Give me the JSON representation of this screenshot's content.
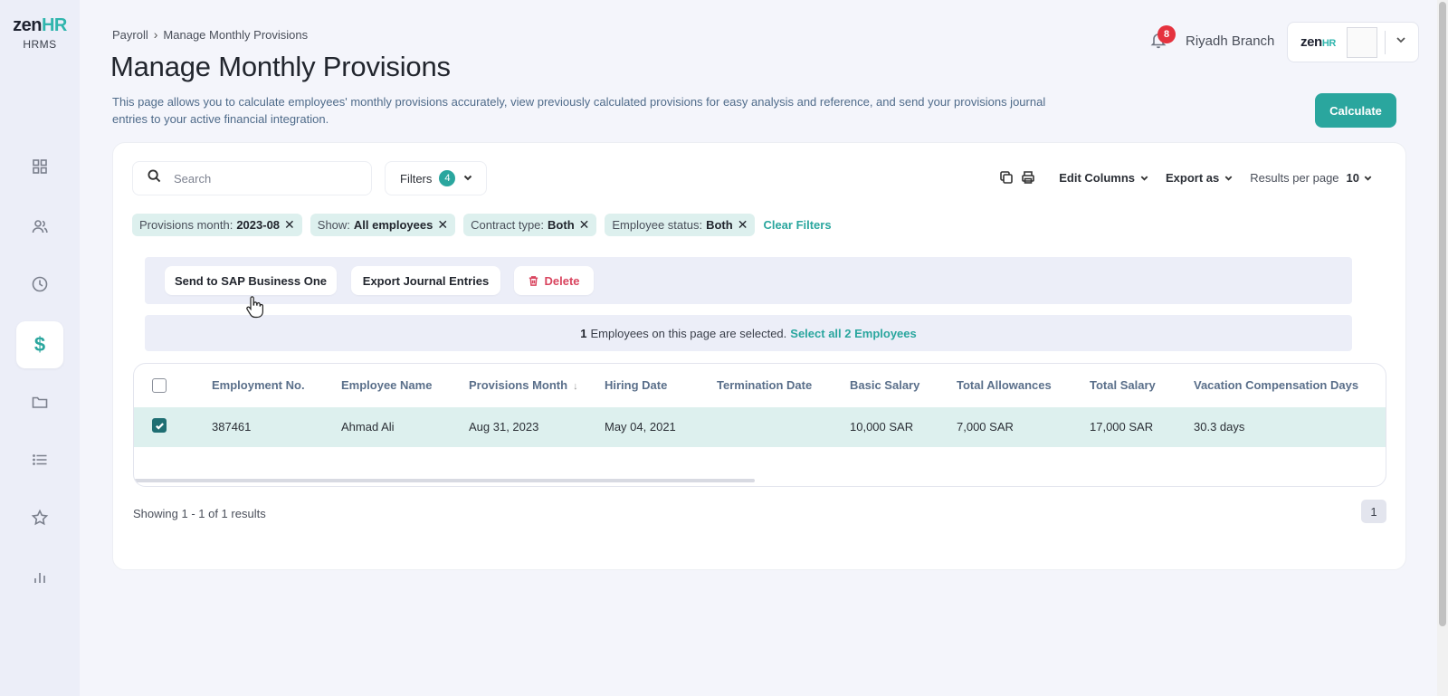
{
  "sidebar": {
    "logo_brand_main": "zen",
    "logo_brand_hr": "HR",
    "logo_sub": "HRMS",
    "items": [
      {
        "name": "dashboard",
        "icon": "grid-icon"
      },
      {
        "name": "employees",
        "icon": "users-icon"
      },
      {
        "name": "time",
        "icon": "clock-icon"
      },
      {
        "name": "payroll",
        "icon": "dollar-icon",
        "glyph": "$",
        "active": true
      },
      {
        "name": "documents",
        "icon": "folder-icon"
      },
      {
        "name": "lists",
        "icon": "list-icon"
      },
      {
        "name": "favorites",
        "icon": "star-icon"
      },
      {
        "name": "reports",
        "icon": "bar-chart-icon"
      }
    ]
  },
  "header": {
    "breadcrumb": [
      "Payroll",
      "Manage Monthly Provisions"
    ],
    "title": "Manage Monthly Provisions",
    "description": "This page allows you to calculate employees' monthly provisions accurately, view previously calculated provisions for easy analysis and reference, and send your provisions journal entries to your active financial integration.",
    "notifications_count": "8",
    "branch": "Riyadh Branch",
    "account_logo_main": "zen",
    "account_logo_hr": "HR",
    "calculate_label": "Calculate"
  },
  "toolbar": {
    "search_placeholder": "Search",
    "filters_label": "Filters",
    "filters_count": "4",
    "edit_columns": "Edit Columns",
    "export_as": "Export as",
    "results_per_page_label": "Results per page",
    "results_per_page_value": "10"
  },
  "chips": [
    {
      "label": "Provisions month:",
      "value": "2023-08"
    },
    {
      "label": "Show:",
      "value": "All employees"
    },
    {
      "label": "Contract type:",
      "value": "Both"
    },
    {
      "label": "Employee status:",
      "value": "Both"
    }
  ],
  "clear_filters": "Clear Filters",
  "actions": {
    "send": "Send to SAP Business One",
    "export_journal": "Export Journal Entries",
    "delete": "Delete"
  },
  "selection": {
    "count": "1",
    "text": "Employees on this page are selected.",
    "select_all": "Select all 2 Employees"
  },
  "table": {
    "columns": [
      "Employment No.",
      "Employee Name",
      "Provisions Month",
      "Hiring Date",
      "Termination Date",
      "Basic Salary",
      "Total Allowances",
      "Total Salary",
      "Vacation Compensation Days"
    ],
    "sort_indicator": "↓",
    "rows": [
      [
        "387461",
        "Ahmad Ali",
        "Aug 31, 2023",
        "May 04, 2021",
        "",
        "10,000 SAR",
        "7,000 SAR",
        "17,000 SAR",
        "30.3 days"
      ]
    ]
  },
  "footer": {
    "showing": "Showing 1 - 1 of 1 results",
    "page": "1"
  },
  "colors": {
    "accent": "#2aa69e",
    "badge": "#e5323e",
    "delete": "#d9455f"
  }
}
